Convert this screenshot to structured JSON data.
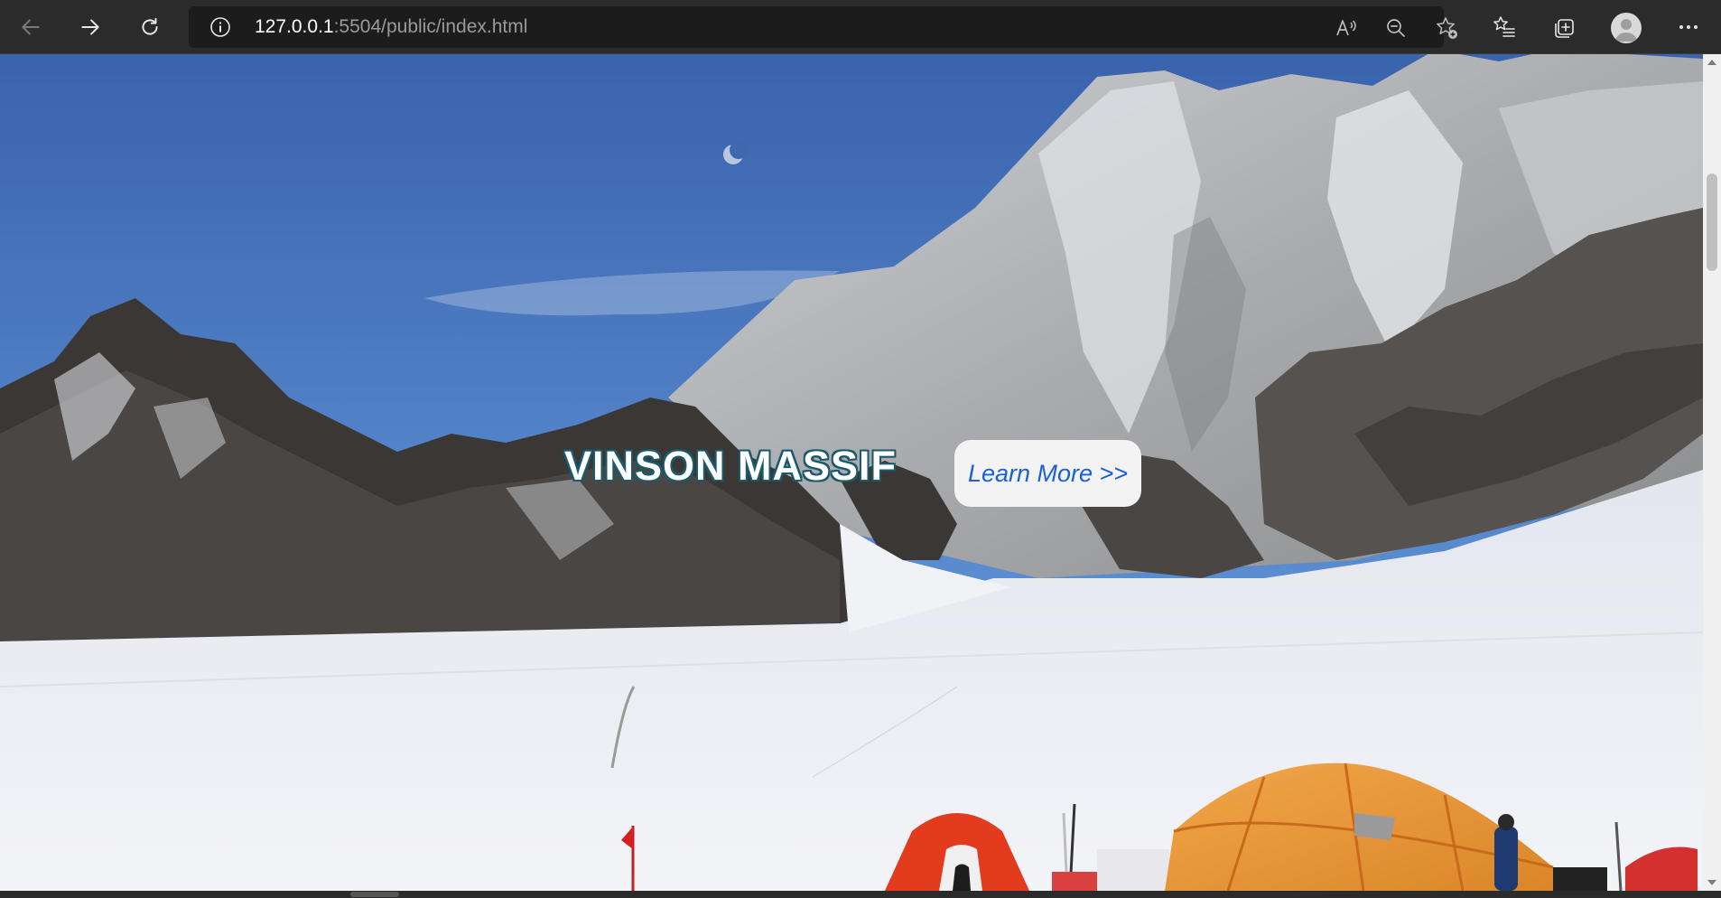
{
  "browser": {
    "url_host": "127.0.0.1",
    "url_rest": ":5504/public/index.html",
    "icons": {
      "back": "arrow-left-icon",
      "forward": "arrow-right-icon",
      "refresh": "refresh-icon",
      "site_info": "info-icon",
      "read_aloud": "read-aloud-icon",
      "zoom_out": "zoom-out-icon",
      "add_favorite": "star-plus-icon",
      "favorites": "favorites-list-icon",
      "collections": "collections-icon",
      "profile": "avatar",
      "menu": "more-icon"
    }
  },
  "hero": {
    "title": "VINSON MASSIF",
    "button_label": "Learn More >>",
    "colors": {
      "title_outline": "#1a5a6a",
      "button_text": "#1a60d8",
      "sky": "#3f6fb8",
      "snow": "#e6e8f0"
    }
  }
}
